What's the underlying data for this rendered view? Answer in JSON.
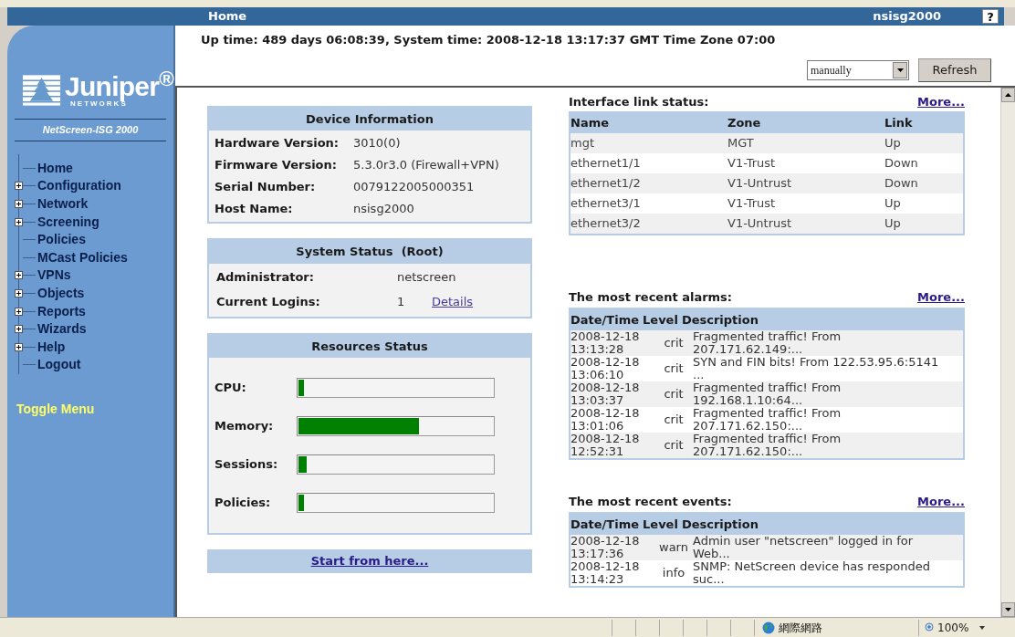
{
  "header": {
    "title": "Home",
    "host": "nsisg2000",
    "help": "?"
  },
  "sidebar": {
    "logo": {
      "name": "Juniper$^{®}$",
      "sub": "NETWORKS"
    },
    "model": "NetScreen-ISG 2000",
    "items": [
      {
        "label": "Home",
        "expandable": false
      },
      {
        "label": "Configuration",
        "expandable": true
      },
      {
        "label": "Network",
        "expandable": true
      },
      {
        "label": "Screening",
        "expandable": true
      },
      {
        "label": "Policies",
        "expandable": false
      },
      {
        "label": "MCast Policies",
        "expandable": false
      },
      {
        "label": "VPNs",
        "expandable": true
      },
      {
        "label": "Objects",
        "expandable": true
      },
      {
        "label": "Reports",
        "expandable": true
      },
      {
        "label": "Wizards",
        "expandable": true
      },
      {
        "label": "Help",
        "expandable": true
      },
      {
        "label": "Logout",
        "expandable": false
      }
    ],
    "toggle": "Toggle Menu"
  },
  "info_line": "Up time: 489 days 06:08:39, System time: 2008-12-18 13:17:37 GMT Time Zone 07:00",
  "refresh": {
    "select_value": "manually",
    "button": "Refresh"
  },
  "device_information": {
    "title": "Device Information",
    "fields": [
      {
        "label": "Hardware Version:",
        "value": "3010(0)"
      },
      {
        "label": "Firmware Version:",
        "value": "5.3.0r3.0 (Firewall+VPN)"
      },
      {
        "label": "Serial Number:",
        "value": "0079122005000351"
      },
      {
        "label": "Host Name:",
        "value": "nsisg2000"
      }
    ]
  },
  "system_status": {
    "title": "System Status  (Root)",
    "administrator": {
      "label": "Administrator:",
      "value": "netscreen"
    },
    "logins": {
      "label": "Current Logins:",
      "value": "1",
      "link": "Details"
    }
  },
  "resources": {
    "title": "Resources Status",
    "meters": [
      {
        "label": "CPU:",
        "level": 0.03
      },
      {
        "label": "Memory:",
        "level": 0.62
      },
      {
        "label": "Sessions:",
        "level": 0.04
      },
      {
        "label": "Policies:",
        "level": 0.03
      }
    ]
  },
  "start_link": "Start from here...",
  "interfaces": {
    "title": "Interface link status:",
    "more": "More...",
    "columns": [
      "Name",
      "Zone",
      "Link"
    ],
    "rows": [
      [
        "mgt",
        "MGT",
        "Up"
      ],
      [
        "ethernet1/1",
        "V1-Trust",
        "Down"
      ],
      [
        "ethernet1/2",
        "V1-Untrust",
        "Down"
      ],
      [
        "ethernet3/1",
        "V1-Trust",
        "Up"
      ],
      [
        "ethernet3/2",
        "V1-Untrust",
        "Up"
      ]
    ]
  },
  "alarms": {
    "title": "The most recent alarms:",
    "more": "More...",
    "columns": [
      "Date/Time",
      "Level",
      "Description"
    ],
    "rows": [
      {
        "datetime": "2008-12-18 13:13:28",
        "level": "crit",
        "description": "Fragmented traffic! From 207.171.62.149:..."
      },
      {
        "datetime": "2008-12-18 13:06:10",
        "level": "crit",
        "description": "SYN and FIN bits! From 122.53.95.6:5141 ..."
      },
      {
        "datetime": "2008-12-18 13:03:37",
        "level": "crit",
        "description": "Fragmented traffic! From 192.168.1.10:64..."
      },
      {
        "datetime": "2008-12-18 13:01:06",
        "level": "crit",
        "description": "Fragmented traffic! From 207.171.62.150:..."
      },
      {
        "datetime": "2008-12-18 12:52:31",
        "level": "crit",
        "description": "Fragmented traffic! From 207.171.62.150:..."
      }
    ]
  },
  "events": {
    "title": "The most recent events:",
    "more": "More...",
    "columns": [
      "Date/Time",
      "Level",
      "Description"
    ],
    "rows": [
      {
        "datetime": "2008-12-18 13:17:36",
        "level": "warn",
        "description": "Admin user \"netscreen\" logged in for Web..."
      },
      {
        "datetime": "2008-12-18 13:14:23",
        "level": "info",
        "description": "SNMP: NetScreen device has responded suc..."
      }
    ]
  },
  "status_bar": {
    "zone": "網際網路",
    "zoom": "100%"
  }
}
